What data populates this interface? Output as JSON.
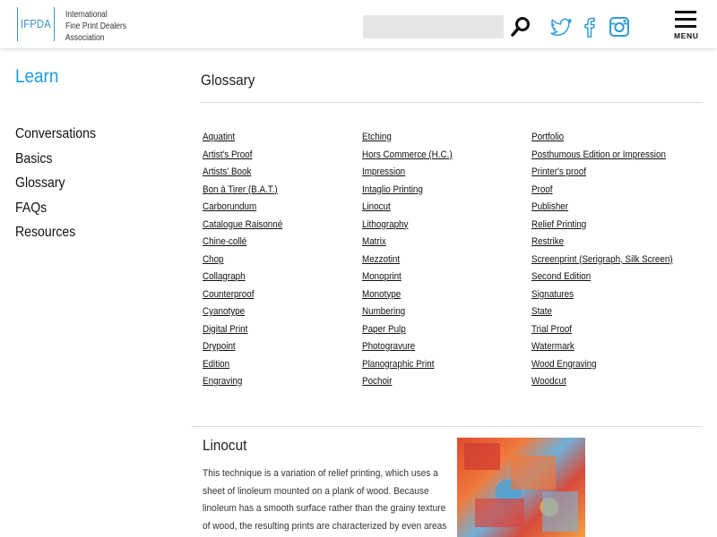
{
  "header": {
    "logo_mark": "IFPDA",
    "logo_lines": [
      "International",
      "Fine Print Dealers",
      "Association"
    ],
    "search_placeholder": "",
    "menu_label": "MENU",
    "colors": {
      "accent": "#3a8fc7",
      "social": "#2f9bd6"
    },
    "icons": [
      "search-icon",
      "twitter-icon",
      "facebook-icon",
      "instagram-icon",
      "hamburger-menu-icon"
    ]
  },
  "sidebar": {
    "title": "Learn",
    "items": [
      "Conversations",
      "Basics",
      "Glossary",
      "FAQs",
      "Resources"
    ]
  },
  "main": {
    "title": "Glossary",
    "columns": [
      [
        "Aquatint",
        "Artist's Proof",
        "Artists' Book",
        "Bon à Tirer (B.A.T.)",
        "Carborundum",
        "Catalogue Raisonné",
        "Chine-collé",
        "Chop",
        "Collagraph",
        "Counterproof",
        "Cyanotype",
        "Digital Print",
        "Drypoint",
        "Edition",
        "Engraving"
      ],
      [
        "Etching",
        "Hors Commerce (H.C.)",
        "Impression",
        "Intaglio Printing",
        "Linocut",
        "Lithography",
        "Matrix",
        "Mezzotint",
        "Monoprint",
        "Monotype",
        "Numbering",
        "Paper Pulp",
        "Photogravure",
        "Planographic Print",
        "Pochoir"
      ],
      [
        "Portfolio",
        "Posthumous Edition or Impression",
        "Printer's proof",
        "Proof",
        "Publisher",
        "Relief Printing",
        "Restrike",
        "Screenprint (Serigraph, Silk Screen)",
        "Second Edition",
        "Signatures",
        "State",
        "Trial Proof",
        "Watermark",
        "Wood Engraving",
        "Woodcut"
      ]
    ],
    "entry": {
      "title": "Linocut",
      "body_lines": [
        "This technique is a variation of relief printing, which uses a",
        "sheet of linoleum mounted on a plank of wood. Because",
        "linoleum has a smooth surface rather than the grainy texture",
        "of wood, the resulting prints are characterized by even areas"
      ]
    }
  }
}
